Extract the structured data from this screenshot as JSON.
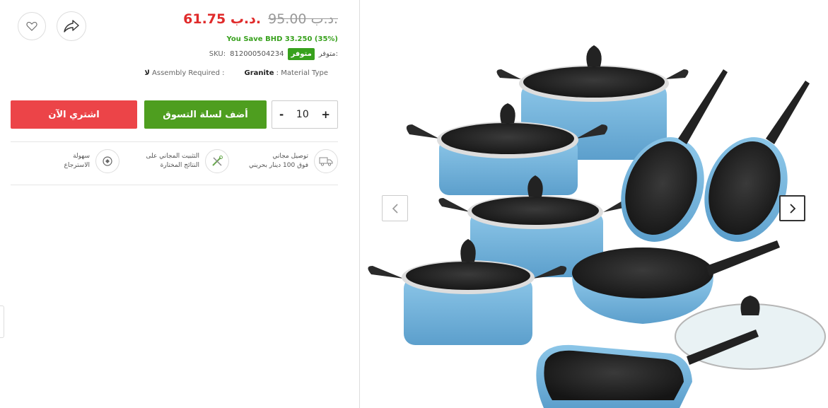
{
  "price": {
    "new": "61.75 د.ب.",
    "old": "95.00 د.ب.",
    "save": "You Save BHD 33.250 (35%)"
  },
  "stock": {
    "label": "متوفر:",
    "badge": "متوفر"
  },
  "sku": {
    "label": "SKU:",
    "value": "812000504234"
  },
  "attributes": {
    "material_value": "Granite",
    "material_label": ": Material Type",
    "assembly_label": "Assembly Required :",
    "assembly_value": "لا"
  },
  "actions": {
    "buy_now": "اشتري الآن",
    "add_to_cart": "أضف لسلة التسوق",
    "qty_minus": "-",
    "qty_value": "10",
    "qty_plus": "+"
  },
  "features": [
    {
      "line1": "توصيل مجاني",
      "line2": "فوق 100 دينار بحريني",
      "icon": "truck-icon"
    },
    {
      "line1": "التثبيت المجاني على",
      "line2": "النتائج المختارة",
      "icon": "tools-icon"
    },
    {
      "line1": "سهولة",
      "line2": "الاسترجاع",
      "icon": "return-icon"
    }
  ],
  "colors": {
    "price_red": "#e02b2b",
    "green": "#4e9e1f",
    "buy_red": "#ec4448",
    "pot_blue": "#7cb8dd"
  }
}
